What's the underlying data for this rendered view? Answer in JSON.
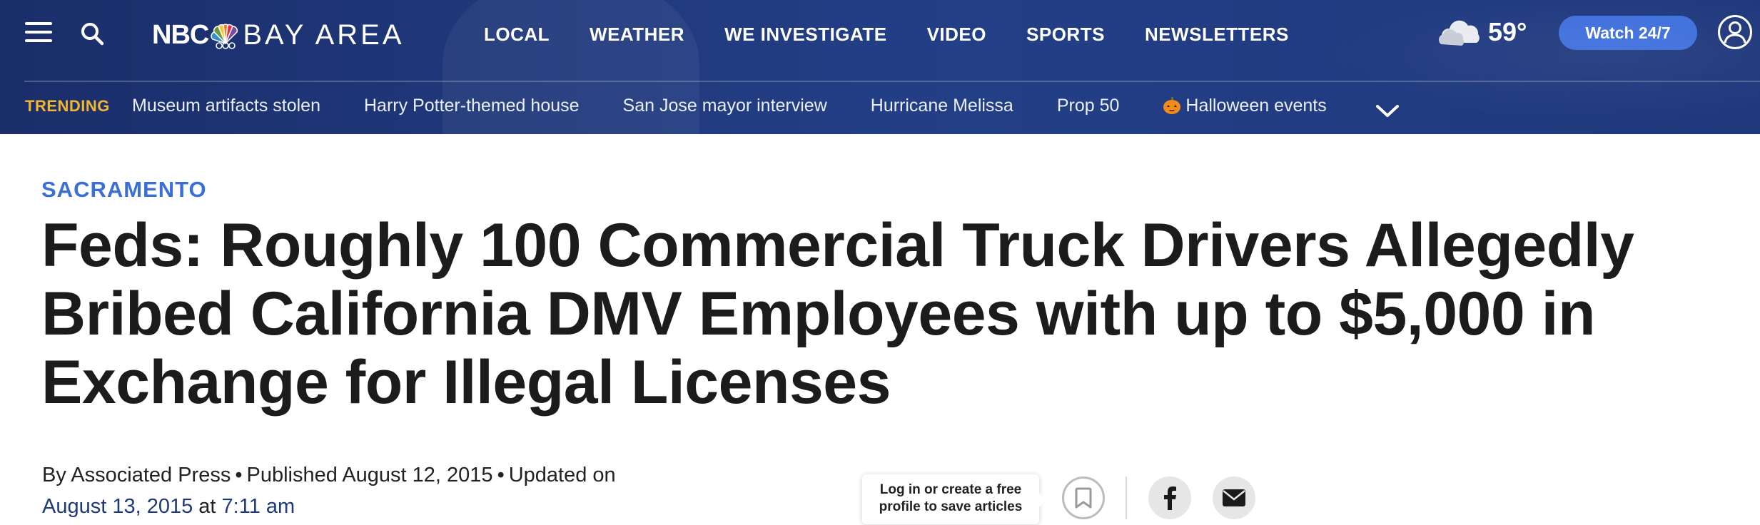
{
  "header": {
    "logo": {
      "nbc": "NBC",
      "bay": "BAY AREA"
    },
    "nav": [
      "LOCAL",
      "WEATHER",
      "WE INVESTIGATE",
      "VIDEO",
      "SPORTS",
      "NEWSLETTERS"
    ],
    "weather": {
      "temp": "59°",
      "icon": "partly-cloudy-icon"
    },
    "watch_label": "Watch 24/7"
  },
  "trending": {
    "label": "TRENDING",
    "items": [
      "Museum artifacts stolen",
      "Harry Potter-themed house",
      "San Jose mayor interview",
      "Hurricane Melissa",
      "Prop 50",
      "Halloween events"
    ]
  },
  "article": {
    "section": "SACRAMENTO",
    "headline": "Feds: Roughly 100 Commercial Truck Drivers Allegedly Bribed California DMV Employees with up to $5,000 in Exchange for Illegal Licenses",
    "byline": {
      "author": "By Associated Press",
      "published": "Published August 12, 2015",
      "updated_label": "Updated on",
      "updated_date": "August 13, 2015",
      "at": "at",
      "updated_time": "7:11 am"
    }
  },
  "tools": {
    "save_tooltip_line1": "Log in or create a free",
    "save_tooltip_line2": "profile to save articles"
  },
  "colors": {
    "header_bg": "#213a7e",
    "accent": "#3e6fdc",
    "trending": "#f0b62e",
    "section": "#3a6fd8"
  }
}
